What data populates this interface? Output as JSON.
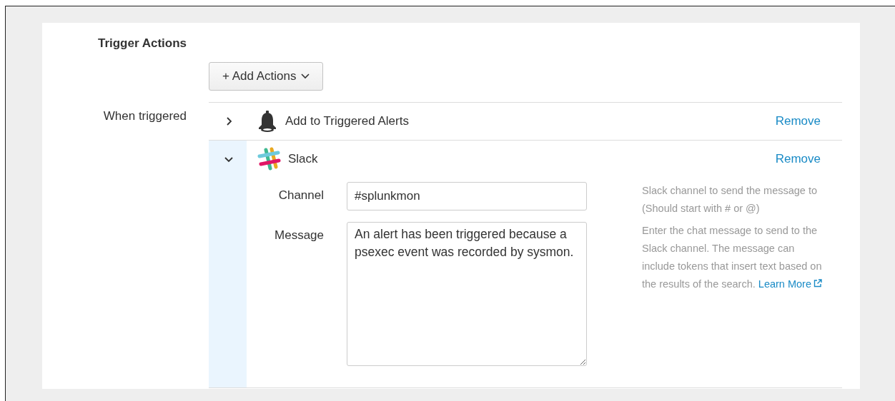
{
  "section": {
    "title": "Trigger Actions",
    "add_button": "+ Add Actions",
    "when_label": "When triggered"
  },
  "actions": [
    {
      "kind": "bell",
      "label": "Add to Triggered Alerts",
      "expanded": false,
      "remove": "Remove"
    },
    {
      "kind": "slack",
      "label": "Slack",
      "expanded": true,
      "remove": "Remove",
      "fields": [
        {
          "kind": "input",
          "label": "Channel",
          "value": "#splunkmon",
          "help": "Slack channel to send the message to (Should start with # or @)"
        },
        {
          "kind": "textarea",
          "label": "Message",
          "value": "An alert has been triggered because a psexec event was recorded by sysmon.",
          "help": "Enter the chat message to send to the Slack channel. The message can include tokens that insert text based on the results of the search.",
          "link": "Learn More"
        }
      ]
    }
  ]
}
